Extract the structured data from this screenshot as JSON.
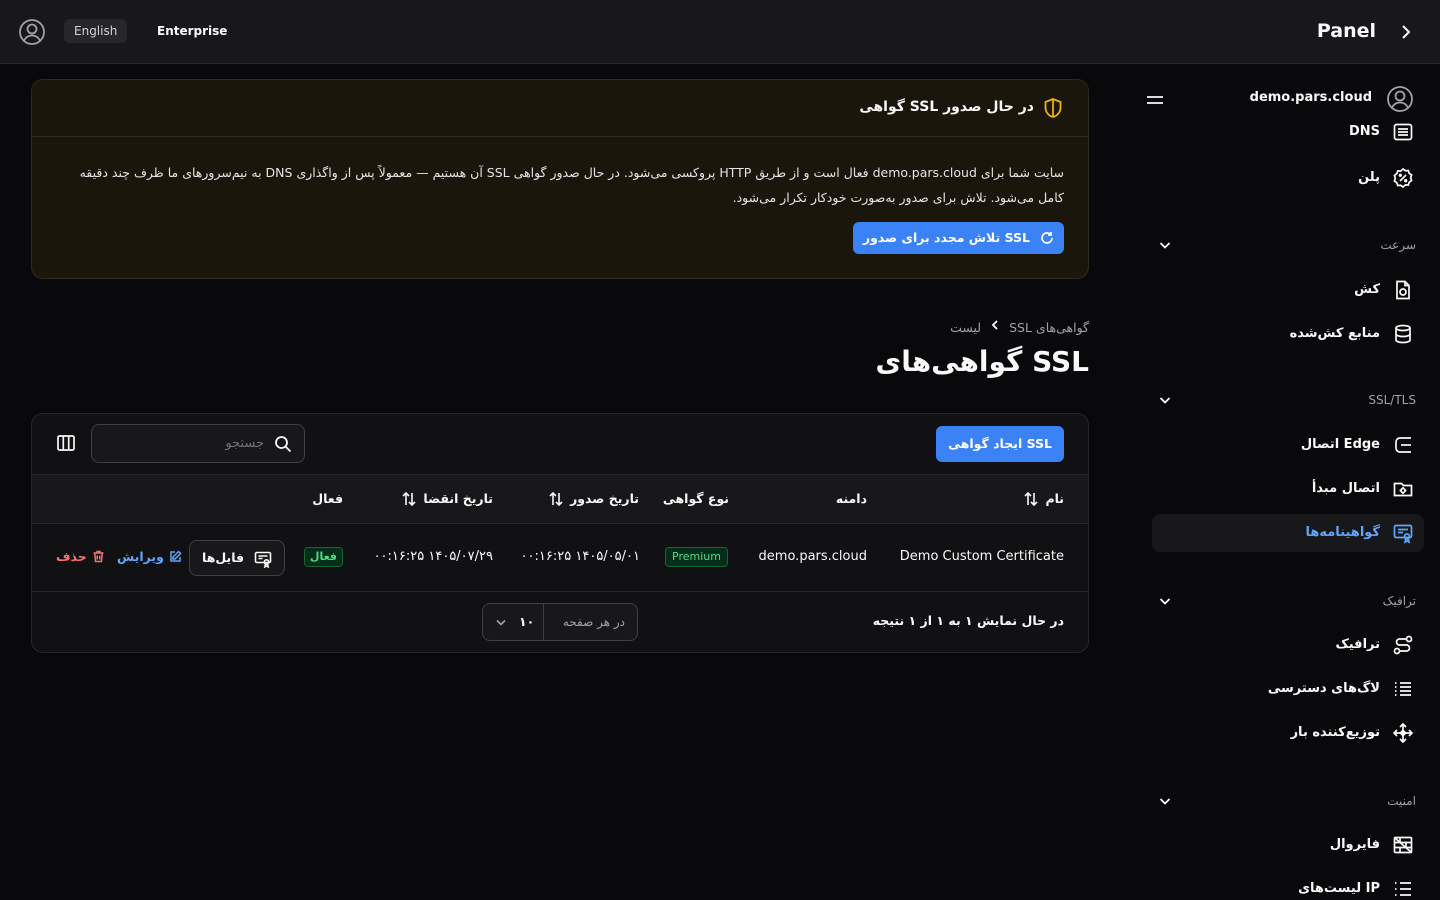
{
  "topbar": {
    "language": "English",
    "plan": "Enterprise",
    "title": "Panel"
  },
  "sidebar": {
    "domain": "demo.pars.cloud",
    "top_items": [
      {
        "label": "DNS",
        "icon": "list-icon"
      },
      {
        "label": "پلن",
        "icon": "plan-badge-icon"
      }
    ],
    "sections": [
      {
        "title": "سرعت",
        "items": [
          {
            "label": "کش",
            "icon": "cache-file-icon"
          },
          {
            "label": "منابع کش‌شده",
            "icon": "database-icon"
          }
        ]
      },
      {
        "title": "SSL/TLS",
        "items": [
          {
            "label": "اتصال Edge",
            "icon": "edge-connection-icon"
          },
          {
            "label": "اتصال مبدأ",
            "icon": "origin-folder-icon"
          },
          {
            "label": "گواهینامه‌ها",
            "icon": "certificate-icon",
            "active": true
          }
        ]
      },
      {
        "title": "ترافیک",
        "items": [
          {
            "label": "ترافیک",
            "icon": "route-icon"
          },
          {
            "label": "لاگ‌های دسترسی",
            "icon": "log-list-icon"
          },
          {
            "label": "توزیع‌کننده بار",
            "icon": "load-balancer-icon"
          }
        ]
      },
      {
        "title": "امنیت",
        "items": [
          {
            "label": "فایروال",
            "icon": "firewall-icon"
          },
          {
            "label": "لیست‌های IP",
            "icon": "ip-list-icon"
          }
        ]
      }
    ]
  },
  "alert": {
    "title": "گواهی SSL در حال صدور",
    "line1": "سایت شما برای demo.pars.cloud فعال است و از طریق HTTP پروکسی می‌شود. در حال صدور گواهی SSL آن هستیم — معمولاً پس از واگذاری DNS به نیم‌سرورهای ما ظرف چند دقیقه",
    "line2": "کامل می‌شود. تلاش برای صدور به‌صورت خودکار تکرار می‌شود.",
    "button": "تلاش مجدد برای صدور SSL"
  },
  "breadcrumb": {
    "parent": "گواهی‌های SSL",
    "current": "لیست"
  },
  "page_title": "گواهی‌های SSL",
  "toolbar": {
    "create": "ایجاد گواهی SSL",
    "search_placeholder": "جستجو"
  },
  "table": {
    "headers": {
      "name": "نام",
      "domain": "دامنه",
      "type": "نوع گواهی",
      "issued": "تاریخ صدور",
      "expires": "تاریخ انقضا",
      "active": "فعال"
    },
    "rows": [
      {
        "name": "Demo Custom Certificate",
        "domain": "demo.pars.cloud",
        "type": "Premium",
        "issued": "۱۴۰۵/۰۵/۰۱ ۰۰:۱۶:۲۵",
        "expires": "۱۴۰۵/۰۷/۲۹ ۰۰:۱۶:۲۵",
        "active": "فعال",
        "files": "فایل‌ها",
        "edit": "ویرایش",
        "delete": "حذف"
      }
    ]
  },
  "footer": {
    "summary": "در حال نمایش ۱ به ۱ از ۱ نتیجه",
    "per_page_label": "در هر صفحه",
    "per_page_value": "۱۰"
  },
  "colors": {
    "accent": "#3b82f6",
    "success": "#4ade80",
    "danger": "#f87171",
    "warning": "#eab308"
  }
}
